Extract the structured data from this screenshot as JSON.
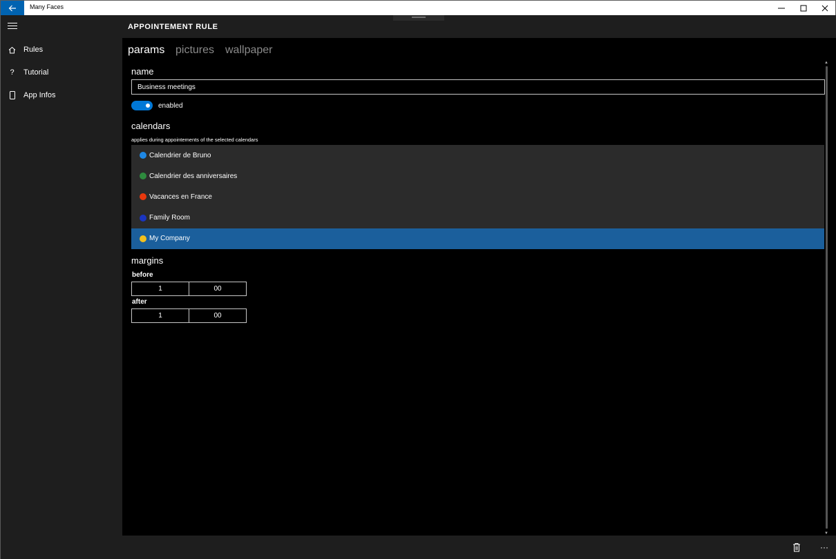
{
  "window": {
    "title": "Many Faces",
    "accent": "#0063b1"
  },
  "sidebar": {
    "items": [
      {
        "label": "Rules",
        "icon": "home-icon"
      },
      {
        "label": "Tutorial",
        "icon": "question-icon"
      },
      {
        "label": "App Infos",
        "icon": "phone-icon"
      }
    ]
  },
  "header": {
    "title": "APPOINTEMENT RULE"
  },
  "tabs": [
    {
      "label": "params",
      "active": true
    },
    {
      "label": "pictures",
      "active": false
    },
    {
      "label": "wallpaper",
      "active": false
    }
  ],
  "params": {
    "name_label": "name",
    "name_value": "Business meetings",
    "enabled_label": "enabled",
    "enabled": true,
    "calendars_label": "calendars",
    "calendars_hint": "applies during appointements of the selected calendars",
    "calendars": [
      {
        "name": "Calendrier de Bruno",
        "color": "#1e88e5",
        "selected": false
      },
      {
        "name": "Calendrier des anniversaires",
        "color": "#2e8b3e",
        "selected": false
      },
      {
        "name": "Vacances en France",
        "color": "#e8380d",
        "selected": false
      },
      {
        "name": "Family Room",
        "color": "#1a35c0",
        "selected": false
      },
      {
        "name": "My Company",
        "color": "#f2c01e",
        "selected": true
      }
    ],
    "margins_label": "margins",
    "before_label": "before",
    "before_hours": "1",
    "before_minutes": "00",
    "after_label": "after",
    "after_hours": "1",
    "after_minutes": "00"
  },
  "commands": {
    "delete_icon": "trash-icon",
    "more_label": "···"
  }
}
